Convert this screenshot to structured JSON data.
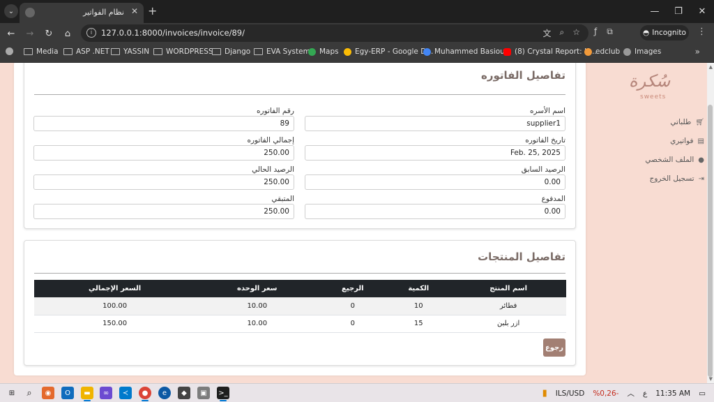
{
  "browser": {
    "tab_title": "نظام الفواتير",
    "url": "127.0.0.1:8000/invoices/invoice/89/",
    "incognito_label": "Incognito",
    "bookmarks": [
      "Media",
      "ASP .NET",
      "YASSIN",
      "WORDPRESS",
      "Django",
      "EVA System",
      "Maps",
      "Egy-ERP - Google D...",
      "Muhammed Basiou...",
      "(8) Crystal Report: H...",
      "edclub",
      "Images"
    ]
  },
  "sidebar": {
    "logo_text": "سُكرة",
    "logo_sub": "sweets",
    "items": [
      {
        "label": "طلباتي",
        "icon": "cart-icon"
      },
      {
        "label": "فواتيري",
        "icon": "file-icon"
      },
      {
        "label": "الملف الشخصي",
        "icon": "user-icon"
      },
      {
        "label": "تسجيل الخروج",
        "icon": "logout-icon"
      }
    ]
  },
  "invoice": {
    "title": "تفاصيل الفاتوره",
    "fields": {
      "supplier_label": "اسم الأسره",
      "supplier_value": "supplier1",
      "number_label": "رقم الفاتوره",
      "number_value": "89",
      "date_label": "تاريخ الفاتوره",
      "date_value": "Feb. 25, 2025",
      "total_label": "إجمالي الفاتوره",
      "total_value": "250.00",
      "prev_balance_label": "الرصيد السابق",
      "prev_balance_value": "0.00",
      "curr_balance_label": "الرصيد الحالي",
      "curr_balance_value": "250.00",
      "paid_label": "المدفوع",
      "paid_value": "0.00",
      "remaining_label": "المتبقي",
      "remaining_value": "250.00"
    }
  },
  "products": {
    "title": "تفاصيل المنتجات",
    "headers": [
      "اسم المنتج",
      "الكمية",
      "الرجيع",
      "سعر الوحده",
      "السعر الإجمالي"
    ],
    "rows": [
      [
        "فطائر",
        "10",
        "0",
        "10.00",
        "100.00"
      ],
      [
        "ازر بلبن",
        "15",
        "0",
        "10.00",
        "150.00"
      ]
    ],
    "back_label": "رجوع"
  },
  "taskbar": {
    "currency": "ILS/USD",
    "change": "%0,26-",
    "lang": "ع",
    "time": "11:35 AM"
  },
  "colors": {
    "page_bg": "#f8dcd2",
    "accent": "#a27f73",
    "table_header": "#212529"
  }
}
